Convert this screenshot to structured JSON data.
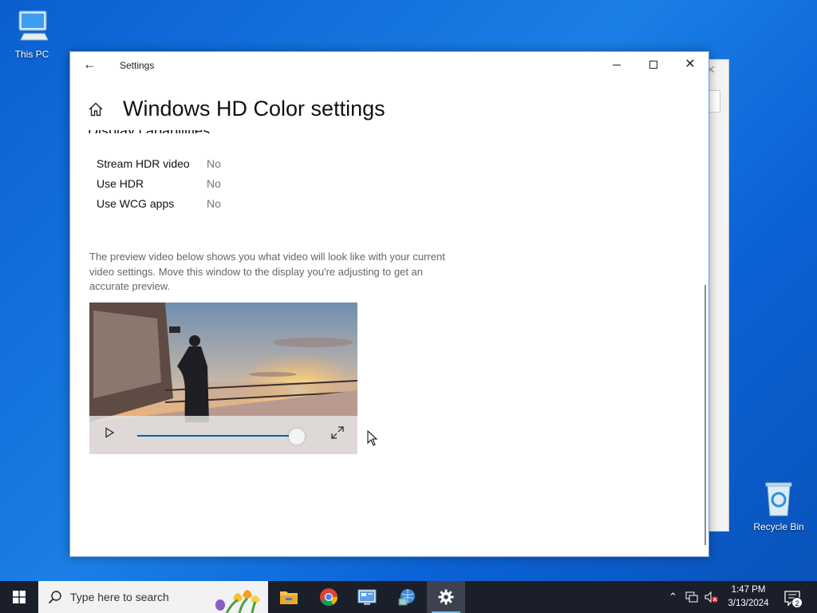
{
  "desktop": {
    "icons": [
      {
        "label": "This PC",
        "icon": "computer-icon"
      },
      {
        "label": "Recycle Bin",
        "icon": "recycle-bin-icon"
      }
    ]
  },
  "window": {
    "app_title": "Settings",
    "page_title": "Windows HD Color settings",
    "section_title": "Display capabilities",
    "capabilities": [
      {
        "label": "Stream HDR video",
        "value": "No"
      },
      {
        "label": "Use HDR",
        "value": "No"
      },
      {
        "label": "Use WCG apps",
        "value": "No"
      }
    ],
    "description": "The preview video below shows you what video will look like with your current video settings. Move this window to the display you're adjusting to get an accurate preview.",
    "video": {
      "progress_fraction": 0.94
    }
  },
  "taskbar": {
    "search_placeholder": "Type here to search",
    "apps": [
      "file-explorer-icon",
      "chrome-icon",
      "control-panel-icon",
      "network-globe-icon",
      "settings-gear-icon"
    ],
    "time": "1:47 PM",
    "date": "3/13/2024",
    "notification_count": "2"
  },
  "colors": {
    "accent": "#0063b1",
    "desktop_blue": "#0a5fd0",
    "taskbar": "#1b1f2a"
  }
}
